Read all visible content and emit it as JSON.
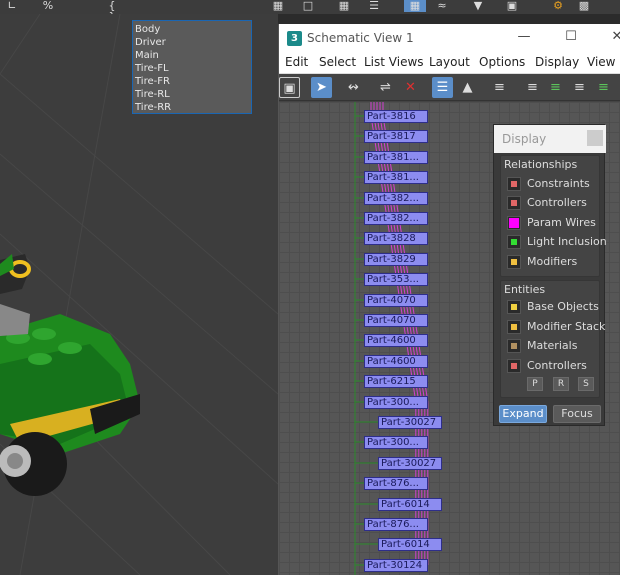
{
  "top_toolbar": {
    "icons": [
      "snap-icon",
      "percent-snap-icon",
      "brace-icon",
      "object-list-icon",
      "curve-editor-icon",
      "layer-icon",
      "schematic-icon",
      "material-icon",
      "render-icon",
      "render-setup-icon",
      "render-frame-icon",
      "settings-icon"
    ],
    "percent_text": "%"
  },
  "dropdown": {
    "items": [
      "Body",
      "Driver",
      "Main",
      "Tire-FL",
      "Tire-FR",
      "Tire-RL",
      "Tire-RR"
    ]
  },
  "schematic": {
    "title": "Schematic View 1",
    "logo": "3",
    "window_buttons": {
      "minimize": "—",
      "maximize": "☐",
      "close": "✕"
    },
    "menu": [
      "Edit",
      "Select",
      "List Views",
      "Layout",
      "Options",
      "Display",
      "View"
    ],
    "toolbar_icons": [
      "display-floater-icon",
      "select-icon",
      "connect-icon",
      "unlink-icon",
      "delete-icon",
      "hierarchy-mode-icon",
      "references-mode-icon",
      "filter-icon",
      "align-left-icon",
      "align-center-icon",
      "arrange-children-icon",
      "arrange-icon"
    ],
    "nodes": [
      {
        "label": "Part-3816",
        "col": 0
      },
      {
        "label": "Part-3817",
        "col": 0
      },
      {
        "label": "Part-381...",
        "col": 0
      },
      {
        "label": "Part-381...",
        "col": 0
      },
      {
        "label": "Part-382...",
        "col": 0
      },
      {
        "label": "Part-382...",
        "col": 0
      },
      {
        "label": "Part-3828",
        "col": 0
      },
      {
        "label": "Part-3829",
        "col": 0
      },
      {
        "label": "Part-353...",
        "col": 0
      },
      {
        "label": "Part-4070",
        "col": 0
      },
      {
        "label": "Part-4070",
        "col": 0
      },
      {
        "label": "Part-4600",
        "col": 0
      },
      {
        "label": "Part-4600",
        "col": 0
      },
      {
        "label": "Part-6215",
        "col": 0
      },
      {
        "label": "Part-300...",
        "col": 0
      },
      {
        "label": "Part-30027",
        "col": 1
      },
      {
        "label": "Part-300...",
        "col": 0
      },
      {
        "label": "Part-30027",
        "col": 1
      },
      {
        "label": "Part-876...",
        "col": 0
      },
      {
        "label": "Part-6014",
        "col": 1
      },
      {
        "label": "Part-876...",
        "col": 0
      },
      {
        "label": "Part-6014",
        "col": 1
      },
      {
        "label": "Part-30124",
        "col": 0
      }
    ]
  },
  "display_panel": {
    "title": "Display",
    "relationships_title": "Relationships",
    "relationships": [
      {
        "label": "Constraints",
        "color": "#e06666"
      },
      {
        "label": "Controllers",
        "color": "#e06666"
      },
      {
        "label": "Param Wires",
        "color": "#ff00ff"
      },
      {
        "label": "Light Inclusion",
        "color": "#33dd33"
      },
      {
        "label": "Modifiers",
        "color": "#f0c040"
      }
    ],
    "entities_title": "Entities",
    "entities": [
      {
        "label": "Base Objects",
        "color": "#f0d040"
      },
      {
        "label": "Modifier Stack",
        "color": "#f0c040"
      },
      {
        "label": "Materials",
        "color": "#b09060"
      },
      {
        "label": "Controllers",
        "color": "#e06666"
      }
    ],
    "prs": [
      "P",
      "R",
      "S"
    ],
    "expand_label": "Expand",
    "focus_label": "Focus"
  },
  "colors": {
    "node_fill": "#8c8cf0",
    "param_wire": "#d040d0",
    "hierarchy_line": "#2a8a2a",
    "active_button": "#5b8ec9"
  }
}
